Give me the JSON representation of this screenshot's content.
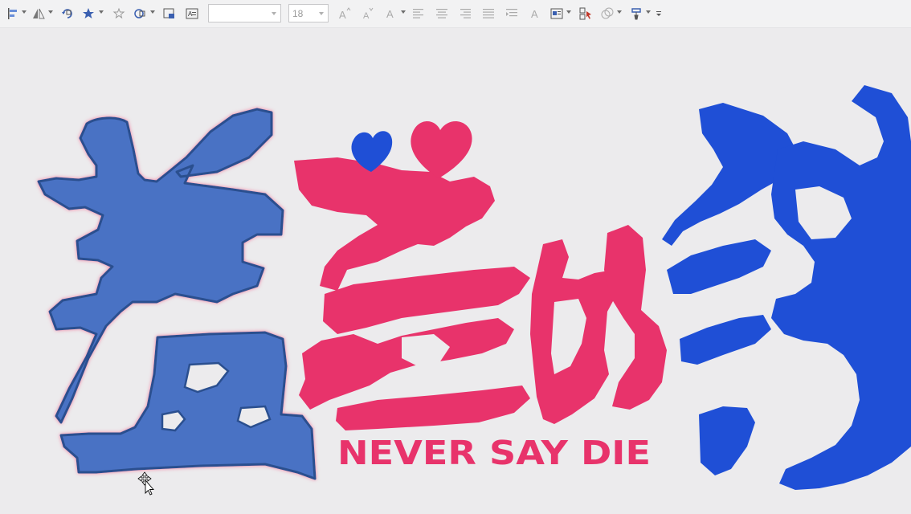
{
  "toolbar": {
    "font_name_value": "",
    "font_size_value": "18",
    "buttons": [
      "align-icon",
      "flip-icon",
      "rotate-icon",
      "effects-icon",
      "style-icon",
      "shape-fill-icon",
      "picture-frame-icon",
      "text-box-icon",
      "grow-font-icon",
      "shrink-font-icon",
      "font-color-icon",
      "align-left-icon",
      "align-center-icon",
      "align-right-icon",
      "justify-icon",
      "distribute-icon",
      "text-style-icon",
      "wrap-icon",
      "selection-pane-icon",
      "group-icon",
      "format-painter-icon",
      "more-icon"
    ]
  },
  "logo": {
    "text": "羞羞的铁",
    "subtitle": "NEVER SAY DIE"
  },
  "colors": {
    "toolbar_bg": "#f2f2f3",
    "canvas_bg": "#ecebed",
    "shape_blue": "#4a72c4",
    "shape_stroke": "#2c4f8f",
    "brand_pink": "#e8336b",
    "brand_blue": "#1f4fd6"
  }
}
